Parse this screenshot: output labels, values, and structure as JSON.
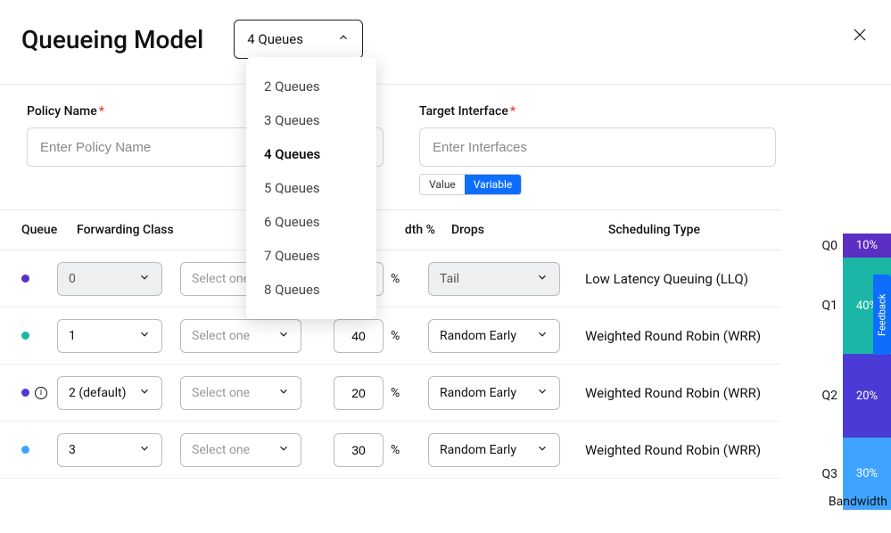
{
  "title": "Queueing Model",
  "queues_select": {
    "selected": "4 Queues",
    "options": [
      "2 Queues",
      "3 Queues",
      "4 Queues",
      "5 Queues",
      "6 Queues",
      "7 Queues",
      "8 Queues"
    ]
  },
  "form": {
    "policy_name_label": "Policy Name",
    "policy_name_placeholder": "Enter Policy Name",
    "target_interface_label": "Target Interface",
    "target_interface_placeholder": "Enter Interfaces",
    "toggle": {
      "value": "Value",
      "variable": "Variable"
    }
  },
  "table": {
    "headers": {
      "queue": "Queue",
      "forwarding_class": "Forwarding Class",
      "bandwidth_pct_suffix": "dth %",
      "drops": "Drops",
      "scheduling_type": "Scheduling Type"
    },
    "select_placeholder": "Select one",
    "bw_unit": "%",
    "rows": [
      {
        "dot": "#5b2ec4",
        "queue": "0",
        "queue_disabled": true,
        "bw": "",
        "drops": "Tail",
        "drops_disabled": true,
        "sched": "Low Latency Queuing (LLQ)",
        "info": false
      },
      {
        "dot": "#1bb6a5",
        "queue": "1",
        "queue_disabled": false,
        "bw": "40",
        "drops": "Random Early",
        "drops_disabled": false,
        "sched": "Weighted Round Robin (WRR)",
        "info": false
      },
      {
        "dot": "#4a3bd6",
        "queue": "2 (default)",
        "queue_disabled": false,
        "bw": "20",
        "drops": "Random Early",
        "drops_disabled": false,
        "sched": "Weighted Round Robin (WRR)",
        "info": true
      },
      {
        "dot": "#3fa4ff",
        "queue": "3",
        "queue_disabled": false,
        "bw": "30",
        "drops": "Random Early",
        "drops_disabled": false,
        "sched": "Weighted Round Robin (WRR)",
        "info": false
      }
    ]
  },
  "chart_data": {
    "type": "bar",
    "title": "Bandwidth",
    "categories": [
      "Q0",
      "Q1",
      "Q2",
      "Q3"
    ],
    "values": [
      10,
      40,
      20,
      30
    ],
    "value_labels": [
      "10%",
      "40%",
      "20%",
      "30%"
    ],
    "colors": [
      "#5b2ec4",
      "#1bb6a5",
      "#4a3bd6",
      "#3fa4ff"
    ],
    "ylabel": "Bandwidth",
    "ylim": [
      0,
      100
    ]
  },
  "feedback_label": "Feedback"
}
